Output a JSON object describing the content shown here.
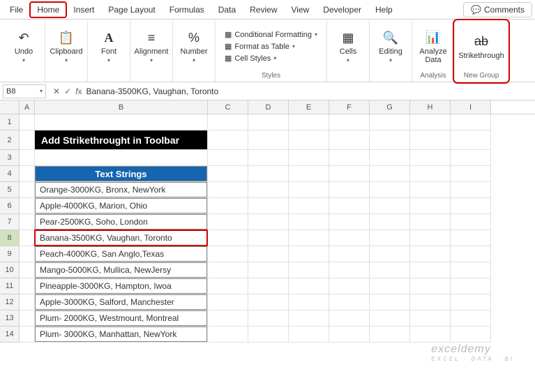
{
  "tabs": [
    "File",
    "Home",
    "Insert",
    "Page Layout",
    "Formulas",
    "Data",
    "Review",
    "View",
    "Developer",
    "Help"
  ],
  "comments_label": "Comments",
  "ribbon": {
    "undo": "Undo",
    "clipboard": "Clipboard",
    "font": "Font",
    "alignment": "Alignment",
    "number": "Number",
    "cond_fmt": "Conditional Formatting",
    "fmt_table": "Format as Table",
    "cell_styles": "Cell Styles",
    "styles_label": "Styles",
    "cells": "Cells",
    "editing": "Editing",
    "analyze": "Analyze\nData",
    "analysis_label": "Analysis",
    "strike": "Strikethrough",
    "newgroup_label": "New Group"
  },
  "name_box": "B8",
  "formula": "Banana-3500KG, Vaughan, Toronto",
  "columns": [
    "A",
    "B",
    "C",
    "D",
    "E",
    "F",
    "G",
    "H",
    "I"
  ],
  "title": "Add Strikethrought in Toolbar",
  "table_header": "Text Strings",
  "rows": [
    "Orange-3000KG, Bronx, NewYork",
    "Apple-4000KG, Marion, Ohio",
    "Pear-2500KG, Soho, London",
    "Banana-3500KG, Vaughan, Toronto",
    "Peach-4000KG, San Anglo,Texas",
    "Mango-5000KG, Mullica, NewJersy",
    "Pineapple-3000KG, Hampton, Iwoa",
    "Apple-3000KG, Salford, Manchester",
    "Plum- 2000KG, Westmount, Montreal",
    "Plum- 3000KG, Manhattan, NewYork"
  ],
  "watermark": "exceldemy",
  "watermark_sub": "EXCEL · DATA · BI"
}
